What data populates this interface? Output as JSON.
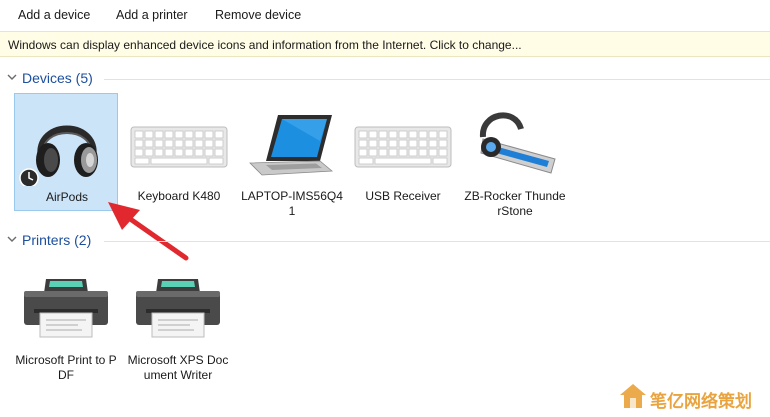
{
  "toolbar": {
    "add_device": "Add a device",
    "add_printer": "Add a printer",
    "remove_device": "Remove device"
  },
  "infobar": {
    "text": "Windows can display enhanced device icons and information from the Internet. Click to change..."
  },
  "devices": {
    "title": "Devices (5)",
    "items": [
      {
        "label": "AirPods",
        "icon": "headphones-icon",
        "selected": true
      },
      {
        "label": "Keyboard K480",
        "icon": "keyboard-icon"
      },
      {
        "label": "LAPTOP-IMS56Q41",
        "icon": "laptop-icon"
      },
      {
        "label": "USB Receiver",
        "icon": "keyboard-icon"
      },
      {
        "label": "ZB-Rocker ThunderStone",
        "icon": "bluetooth-headset-icon"
      }
    ]
  },
  "printers": {
    "title": "Printers (2)",
    "items": [
      {
        "label": "Microsoft Print to PDF",
        "icon": "printer-icon"
      },
      {
        "label": "Microsoft XPS Document Writer",
        "icon": "printer-icon"
      }
    ]
  },
  "watermark": {
    "text": "笔亿网络策划"
  },
  "colors": {
    "accent": "#1c4f9c",
    "selection": "#cce4f7",
    "infobar": "#fffde6",
    "annotation_arrow": "#e0282e"
  }
}
